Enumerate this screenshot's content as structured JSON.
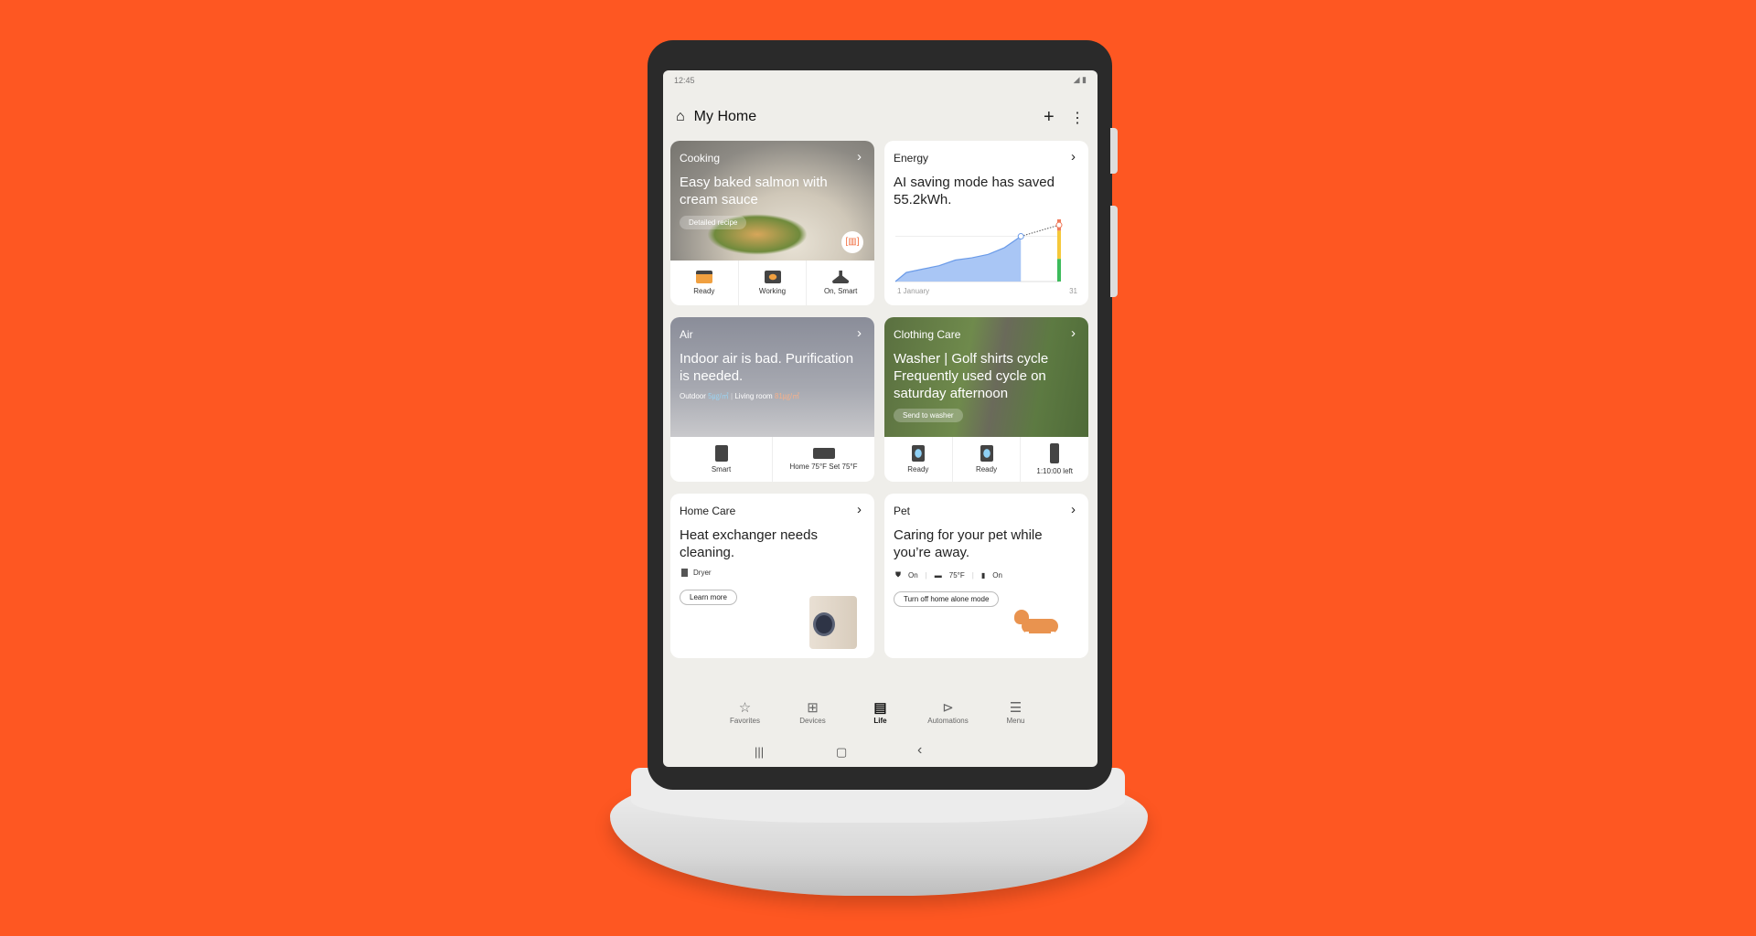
{
  "status": {
    "time": "12:45",
    "icons": "signal-battery"
  },
  "header": {
    "title": "My Home",
    "icon": "home-icon",
    "add": "+",
    "more": "⋮"
  },
  "cards": {
    "cooking": {
      "title": "Cooking",
      "headline": "Easy baked salmon with cream sauce",
      "button": "Detailed recipe",
      "devices": [
        {
          "label": "Ready",
          "icon": "oven-icon"
        },
        {
          "label": "Working",
          "icon": "cooktop-icon"
        },
        {
          "label": "On, Smart",
          "icon": "hood-icon"
        }
      ]
    },
    "energy": {
      "title": "Energy",
      "headline": "AI saving mode has saved 55.2kWh.",
      "x_start": "1 January",
      "x_end": "31"
    },
    "air": {
      "title": "Air",
      "headline": "Indoor air is bad. Purification is needed.",
      "outdoor_label": "Outdoor",
      "outdoor_value": "5㎍/㎥",
      "room_label": "Living room",
      "room_value": "81㎍/㎥",
      "devices": [
        {
          "label": "Smart",
          "icon": "air-purifier-icon"
        },
        {
          "label": "Home 75°F Set 75°F",
          "icon": "air-conditioner-icon"
        }
      ]
    },
    "clothing": {
      "title": "Clothing Care",
      "headline": "Washer | Golf shirts cycle Frequently used cycle on saturday afternoon",
      "button": "Send to washer",
      "devices": [
        {
          "label": "Ready",
          "icon": "washer-icon"
        },
        {
          "label": "Ready",
          "icon": "dryer-icon"
        },
        {
          "label": "1:10:00 left",
          "icon": "styler-icon"
        }
      ]
    },
    "homecare": {
      "title": "Home Care",
      "headline": "Heat exchanger needs cleaning.",
      "device": "Dryer",
      "button": "Learn more"
    },
    "pet": {
      "title": "Pet",
      "headline": "Caring for your pet while you’re away.",
      "statuses": [
        "On",
        "75°F",
        "On"
      ],
      "button": "Turn off home alone mode"
    }
  },
  "chart_data": {
    "type": "area",
    "x": [
      1,
      3,
      6,
      9,
      12,
      15,
      18,
      21,
      24,
      31
    ],
    "values": [
      0,
      8,
      11,
      14,
      19,
      21,
      24,
      30,
      40,
      46
    ],
    "projection_end": 50,
    "xlabels": [
      "1 January",
      "31"
    ],
    "colors": {
      "area": "#a9c6f5",
      "line": "#6b9be8",
      "gauge": [
        "#f07a5a",
        "#f5c83a",
        "#3dbb5b"
      ]
    }
  },
  "nav": [
    {
      "label": "Favorites",
      "icon": "☆"
    },
    {
      "label": "Devices",
      "icon": "⊞"
    },
    {
      "label": "Life",
      "icon": "▤"
    },
    {
      "label": "Automations",
      "icon": "⊳"
    },
    {
      "label": "Menu",
      "icon": "☰"
    }
  ],
  "sysnav": {
    "recent": "|||",
    "home": "▢",
    "back": "‹"
  }
}
